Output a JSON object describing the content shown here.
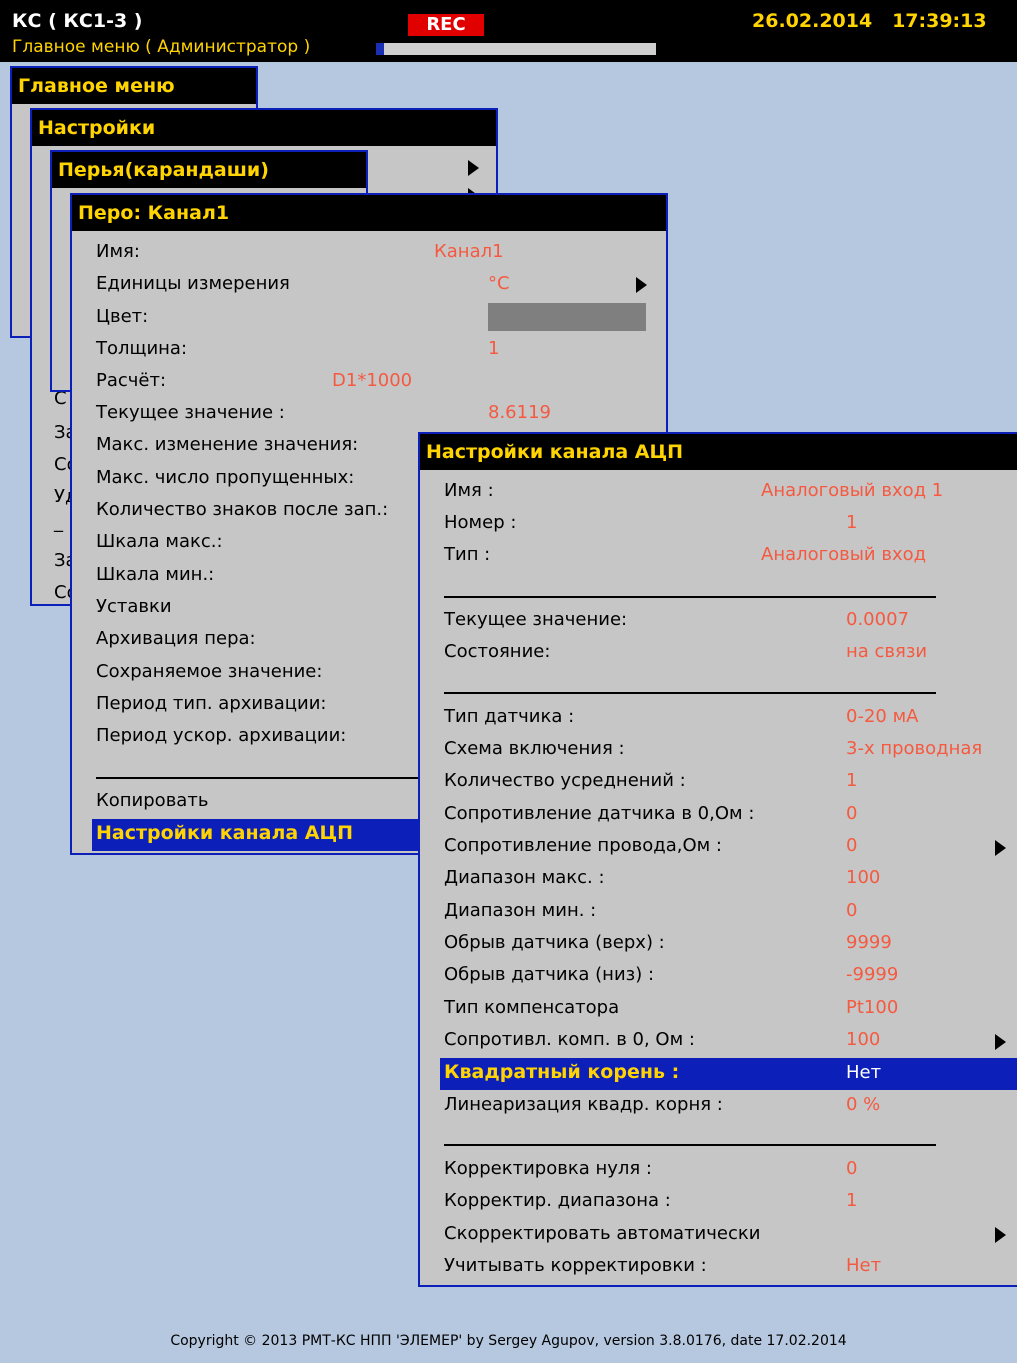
{
  "header": {
    "device_title": "КС ( КС1-3 )",
    "subtitle": "Главное меню ( Администратор )",
    "rec_label": "REC",
    "date": "26.02.2014",
    "time": "17:39:13"
  },
  "windows": {
    "main_menu_title": "Главное меню",
    "settings_title": "Настройки",
    "pens_title": "Перья(карандаши)",
    "pen_title": "Перо: Канал1",
    "adc_title": "Настройки канала АЦП"
  },
  "fragments": {
    "f1": "С",
    "f2": "За",
    "f3": "Со",
    "f4": "Уд",
    "f5": "_",
    "f6": "За",
    "f7": "Со"
  },
  "pen": {
    "name_label": "Имя:",
    "name_value": "Канал1",
    "units_label": "Единицы измерения",
    "units_value": "°C",
    "color_label": "Цвет:",
    "color_value": "#7f7f7f",
    "thickness_label": "Толщина:",
    "thickness_value": "1",
    "calc_label": "Расчёт:",
    "calc_value": "D1*1000",
    "current_label": "Текущее значение :",
    "current_value": "8.6119",
    "max_change_label": "Макс. изменение значения:",
    "max_missed_label": "Макс. число пропущенных:",
    "decimals_label": "Количество знаков после зап.:",
    "scale_max_label": "Шкала макс.:",
    "scale_min_label": "Шкала мин.:",
    "setpoints_label": "Уставки",
    "archive_label": "Архивация пера:",
    "saved_value_label": "Сохраняемое значение:",
    "archive_period_label": "Период тип. архивации:",
    "fast_archive_label": "Период ускор. архивации:",
    "copy_label": "Копировать",
    "adc_settings_label": "Настройки канала АЦП"
  },
  "adc": {
    "name_label": "Имя :",
    "name_value": "Аналоговый вход 1",
    "number_label": "Номер :",
    "number_value": "1",
    "type_label": "Тип :",
    "type_value": "Аналоговый вход",
    "current_label": "Текущее значение:",
    "current_value": "0.0007",
    "state_label": "Состояние:",
    "state_value": "на связи",
    "sensor_type_label": "Тип датчика :",
    "sensor_type_value": "0-20 мА",
    "scheme_label": "Схема включения :",
    "scheme_value": "3-х проводная",
    "averaging_label": "Количество усреднений :",
    "averaging_value": "1",
    "sensor_res_label": "Сопротивление датчика в 0,Ом :",
    "sensor_res_value": "0",
    "wire_res_label": "Сопротивление провода,Ом :",
    "wire_res_value": "0",
    "range_max_label": "Диапазон макс. :",
    "range_max_value": "100",
    "range_min_label": "Диапазон мин. :",
    "range_min_value": "0",
    "break_high_label": "Обрыв датчика (верх) :",
    "break_high_value": "9999",
    "break_low_label": "Обрыв датчика (низ) :",
    "break_low_value": "-9999",
    "comp_type_label": "Тип компенсатора",
    "comp_type_value": "Pt100",
    "comp_res_label": "Сопротивл. комп. в 0, Ом :",
    "comp_res_value": "100",
    "sqrt_label": "Квадратный корень :",
    "sqrt_value": "Нет",
    "sqrt_lin_label": "Линеаризация квадр. корня :",
    "sqrt_lin_value": "0 %",
    "zero_corr_label": "Корректировка нуля :",
    "zero_corr_value": "0",
    "range_corr_label": "Корректир. диапазона :",
    "range_corr_value": "1",
    "auto_corr_label": "Скорректировать автоматически",
    "use_corr_label": "Учитывать корректировки :",
    "use_corr_value": "Нет"
  },
  "progress": {
    "fraction": 0.03
  },
  "footer": {
    "copyright": "Copyright © 2013 РМТ-КС НПП 'ЭЛЕМЕР' by Sergey Agupov, version 3.8.0176, date 17.02.2014"
  }
}
